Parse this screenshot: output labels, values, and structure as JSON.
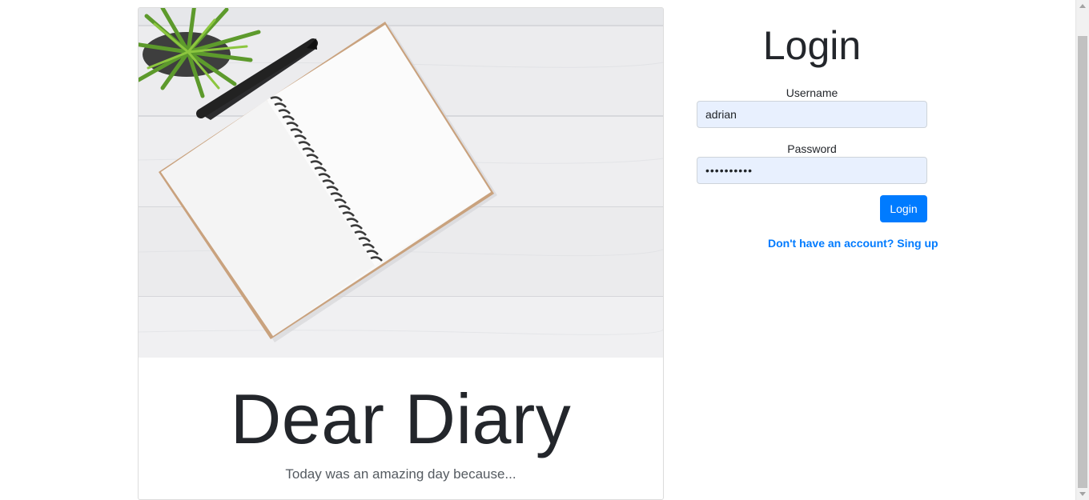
{
  "card": {
    "title": "Dear Diary",
    "subtitle": "Today was an amazing day because..."
  },
  "login": {
    "heading": "Login",
    "username_label": "Username",
    "username_value": "adrian",
    "password_label": "Password",
    "password_value": "••••••••••",
    "button_label": "Login",
    "signup_link": "Don't have an account? Sing up"
  },
  "colors": {
    "accent": "#007bff",
    "autofill_bg": "#e8f0fe",
    "heading_text": "#23262b"
  },
  "icons": {
    "image": "notebook-photo",
    "scroll_up": "scroll-up-arrow-icon",
    "scroll_down": "scroll-down-arrow-icon"
  }
}
